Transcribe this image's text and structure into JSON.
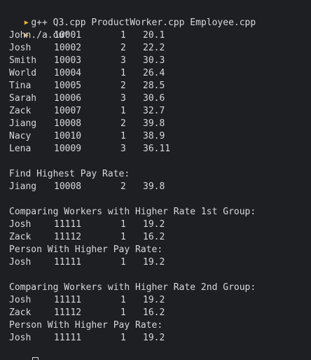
{
  "colors": {
    "background": "#1e1f22",
    "text": "#d7d9dc",
    "prompt_accent": "#e3b341"
  },
  "terminal": {
    "prompt_icon": "chevron-right-icon",
    "compile_command": "g++ Q3.cpp ProductWorker.cpp Employee.cpp",
    "run_command": "./a.out",
    "workers": [
      {
        "name": "John",
        "id": "10001",
        "group": "1",
        "rate": "20.1"
      },
      {
        "name": "Josh",
        "id": "10002",
        "group": "2",
        "rate": "22.2"
      },
      {
        "name": "Smith",
        "id": "10003",
        "group": "3",
        "rate": "30.3"
      },
      {
        "name": "World",
        "id": "10004",
        "group": "1",
        "rate": "26.4"
      },
      {
        "name": "Tina",
        "id": "10005",
        "group": "2",
        "rate": "28.5"
      },
      {
        "name": "Sarah",
        "id": "10006",
        "group": "3",
        "rate": "30.6"
      },
      {
        "name": "Zack",
        "id": "10007",
        "group": "1",
        "rate": "32.7"
      },
      {
        "name": "Jiang",
        "id": "10008",
        "group": "2",
        "rate": "39.8"
      },
      {
        "name": "Nacy",
        "id": "10010",
        "group": "1",
        "rate": "38.9"
      },
      {
        "name": "Lena",
        "id": "10009",
        "group": "3",
        "rate": "36.11"
      }
    ],
    "highest_heading": "Find Highest Pay Rate:",
    "highest": {
      "name": "Jiang",
      "id": "10008",
      "group": "2",
      "rate": "39.8"
    },
    "group1_heading": "Comparing Workers with Higher Rate 1st Group:",
    "group1_rows": [
      {
        "name": "Josh",
        "id": "11111",
        "group": "1",
        "rate": "19.2"
      },
      {
        "name": "Zack",
        "id": "11112",
        "group": "1",
        "rate": "16.2"
      }
    ],
    "group1_result_heading": "Person With Higher Pay Rate:",
    "group1_result": {
      "name": "Josh",
      "id": "11111",
      "group": "1",
      "rate": "19.2"
    },
    "group2_heading": "Comparing Workers with Higher Rate 2nd Group:",
    "group2_rows": [
      {
        "name": "Josh",
        "id": "11111",
        "group": "1",
        "rate": "19.2"
      },
      {
        "name": "Zack",
        "id": "11112",
        "group": "1",
        "rate": "16.2"
      }
    ],
    "group2_result_heading": "Person With Higher Pay Rate:",
    "group2_result": {
      "name": "Josh",
      "id": "11111",
      "group": "1",
      "rate": "19.2"
    }
  }
}
